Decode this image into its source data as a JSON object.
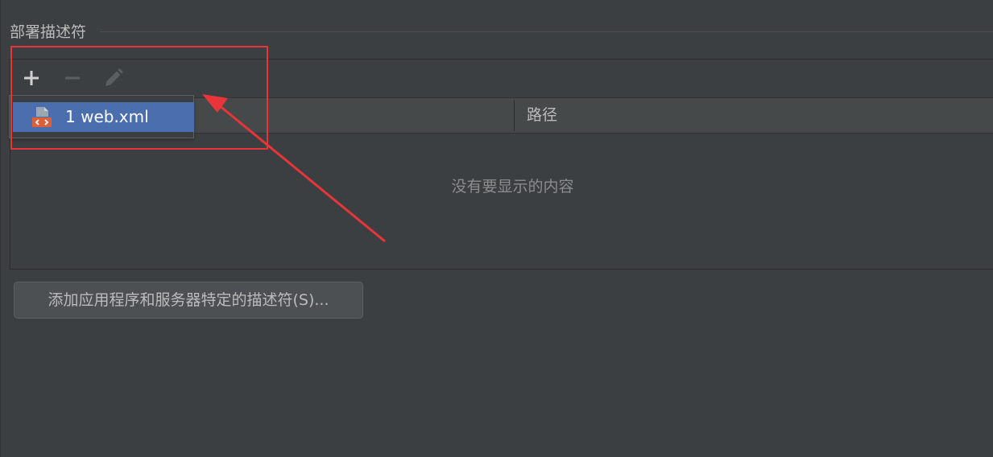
{
  "section": {
    "title": "部署描述符"
  },
  "toolbar": {
    "add_icon": "plus-icon",
    "remove_icon": "minus-icon",
    "edit_icon": "pencil-icon"
  },
  "table": {
    "columns": [
      "",
      "路径"
    ],
    "empty_text": "没有要显示的内容"
  },
  "popup": {
    "items": [
      {
        "label": "1  web.xml",
        "icon": "xml-file-icon",
        "selected": true
      }
    ]
  },
  "actions": {
    "add_descriptor_label": "添加应用程序和服务器特定的描述符(S)..."
  },
  "colors": {
    "background": "#3c3f41",
    "selection": "#4b6eaf",
    "annotation_red": "#e8353a",
    "text": "#bbbbbb",
    "muted_text": "#8c8c8c"
  }
}
